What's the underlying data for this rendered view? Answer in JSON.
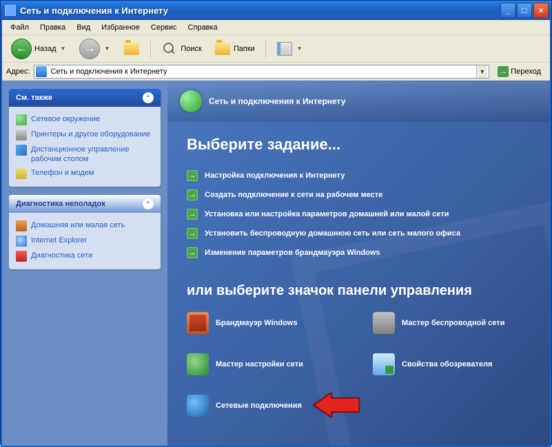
{
  "window": {
    "title": "Сеть и подключения к Интернету"
  },
  "menu": {
    "file": "Файл",
    "edit": "Правка",
    "view": "Вид",
    "favorites": "Избранное",
    "tools": "Сервис",
    "help": "Справка"
  },
  "toolbar": {
    "back": "Назад",
    "search": "Поиск",
    "folders": "Папки"
  },
  "address": {
    "label": "Адрес:",
    "value": "Сеть и подключения к Интернету",
    "go": "Переход"
  },
  "sidepanel": {
    "seealso": {
      "title": "См. также",
      "items": [
        "Сетевое окружение",
        "Принтеры и другое оборудование",
        "Дистанционное управление рабочим столом",
        "Телефон и модем"
      ]
    },
    "troubleshoot": {
      "title": "Диагностика неполадок",
      "items": [
        "Домашняя или малая сеть",
        "Internet Explorer",
        "Диагностика сети"
      ]
    }
  },
  "main": {
    "header": "Сеть и подключения к Интернету",
    "h1": "Выберите задание...",
    "tasks": [
      "Настройка подключения к Интернету",
      "Создать подключение к сети на рабочем месте",
      "Установка или настройка параметров домашней или малой сети",
      "Установить беспроводную домашнюю сеть или сеть малого офиса",
      "Изменение параметров брандмауэра Windows"
    ],
    "h2": "или выберите значок панели управления",
    "icons": [
      "Брандмауэр Windows",
      "Мастер беспроводной сети",
      "Мастер настройки сети",
      "Свойства обозревателя",
      "Сетевые подключения"
    ]
  }
}
